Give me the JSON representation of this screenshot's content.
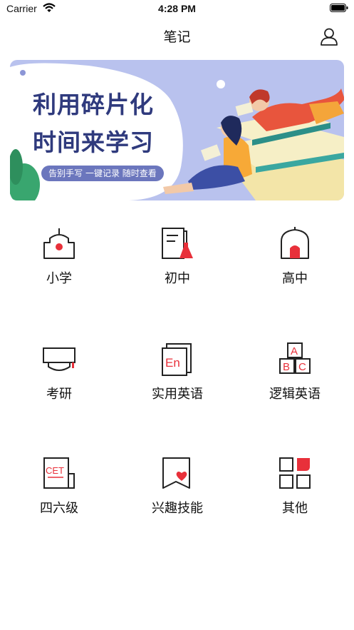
{
  "status": {
    "carrier": "Carrier",
    "time": "4:28 PM"
  },
  "nav": {
    "title": "笔记"
  },
  "banner": {
    "line1": "利用碎片化",
    "line2": "时间来学习",
    "pill": "告别手写 一键记录 随时查看"
  },
  "categories": [
    {
      "label": "小学",
      "icon": "school-icon"
    },
    {
      "label": "初中",
      "icon": "book-flask-icon"
    },
    {
      "label": "高中",
      "icon": "arch-door-icon"
    },
    {
      "label": "考研",
      "icon": "grad-cap-icon"
    },
    {
      "label": "实用英语",
      "icon": "en-book-icon"
    },
    {
      "label": "逻辑英语",
      "icon": "abc-blocks-icon"
    },
    {
      "label": "四六级",
      "icon": "cet-doc-icon"
    },
    {
      "label": "兴趣技能",
      "icon": "heart-bookmark-icon"
    },
    {
      "label": "其他",
      "icon": "grid-squares-icon"
    }
  ],
  "colors": {
    "accent": "#e8303a",
    "banner_bg": "#b9c2ee",
    "title_text": "#2f3a7d"
  }
}
